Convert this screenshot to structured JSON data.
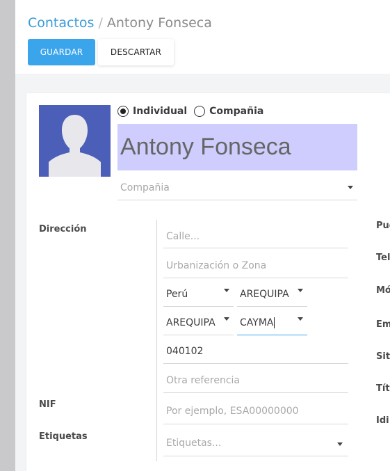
{
  "breadcrumb": {
    "parent": "Contactos",
    "separator": "/",
    "current": "Antony Fonseca"
  },
  "buttons": {
    "save": "GUARDAR",
    "discard": "DESCARTAR"
  },
  "contact_type": {
    "options": [
      "Individual",
      "Compañia"
    ],
    "selected": "Individual"
  },
  "name": "Antony Fonseca",
  "company": {
    "placeholder": "Compañia"
  },
  "address": {
    "label": "Dirección",
    "street_placeholder": "Calle...",
    "zone_placeholder": "Urbanización o Zona",
    "country": "Perú",
    "department": "AREQUIPA",
    "province": "AREQUIPA",
    "district": "CAYMA",
    "zip": "040102",
    "reference_placeholder": "Otra referencia"
  },
  "nif": {
    "label": "NIF",
    "placeholder": "Por ejemplo, ESA00000000"
  },
  "tags": {
    "label": "Etiquetas",
    "placeholder": "Etiquetas..."
  },
  "right_labels": [
    "Pue",
    "Tel",
    "Mó",
    "Em",
    "Siti",
    "Títu",
    "Idi"
  ],
  "colors": {
    "accent": "#3ba5ec",
    "link": "#3a9bd9",
    "name_highlight": "#cfcdfd",
    "avatar_bg": "#4c5fb8",
    "active_underline": "#3ba5ec"
  }
}
